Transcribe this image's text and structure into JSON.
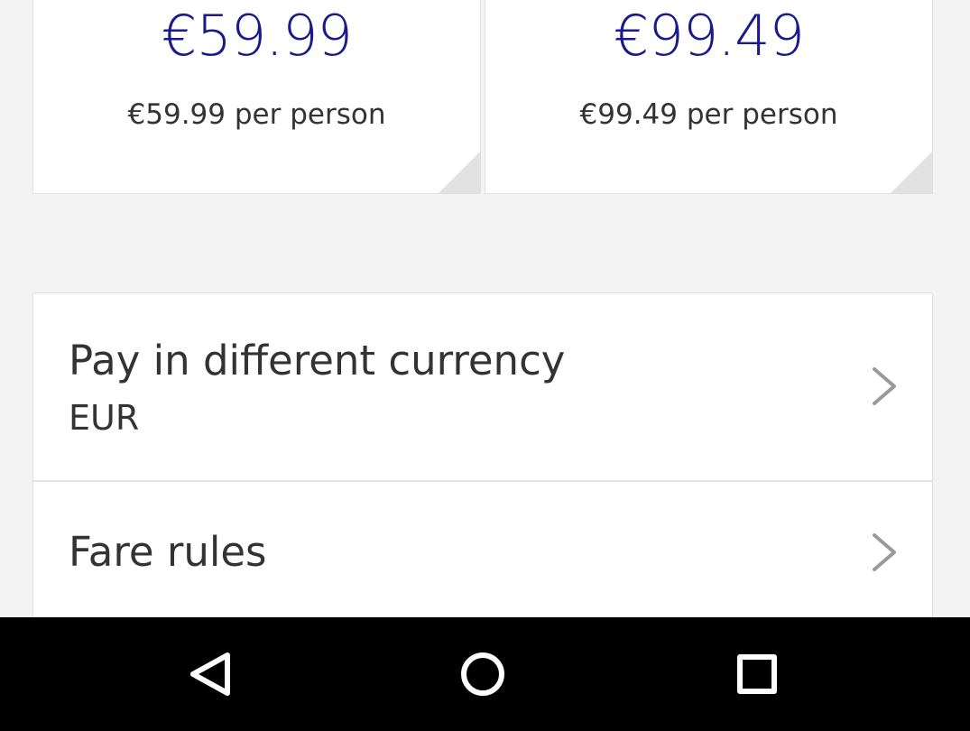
{
  "fares": [
    {
      "price": "€59.99",
      "per_person": "€59.99 per person"
    },
    {
      "price": "€99.49",
      "per_person": "€99.49 per person"
    }
  ],
  "options": {
    "currency": {
      "title": "Pay in different currency",
      "value": "EUR",
      "icon": "chevron-right-icon"
    },
    "fare_rules": {
      "title": "Fare rules",
      "icon": "chevron-right-icon"
    }
  },
  "nav_bar": {
    "back_icon": "back-triangle-icon",
    "home_icon": "home-circle-icon",
    "recents_icon": "recents-square-icon"
  },
  "colors": {
    "price": "#1a1a8a",
    "text": "#333333",
    "background": "#f3f3f3",
    "card": "#ffffff",
    "chevron": "#9a9a9a",
    "nav_bar": "#000000"
  }
}
